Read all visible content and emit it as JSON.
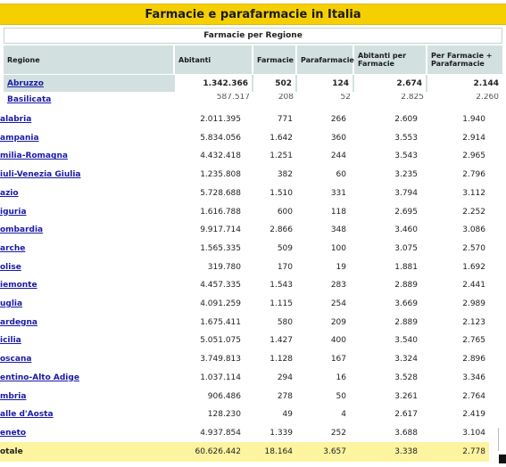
{
  "title": "Farmacie e parafarmacie in Italia",
  "caption": "Farmacie per Regione",
  "headers": [
    "Regione",
    "Abitanti",
    "Farmacie",
    "Parafarmacie",
    "Abitanti per Farmacie",
    "Per Farmacie + Parafarmacie"
  ],
  "highlight_row": {
    "region": "Abruzzo",
    "abitanti": "1.342.366",
    "farmacie": "502",
    "parafarmacie": "124",
    "ab_farmacie": "2.674",
    "ab_farm_para": "2.144"
  },
  "partial_row": {
    "region": "Basilicata",
    "abitanti": "587.517",
    "farmacie": "208",
    "parafarmacie": "52",
    "ab_farmacie": "2.825",
    "ab_farm_para": "2.260"
  },
  "rows": [
    {
      "region": "alabria",
      "abitanti": "2.011.395",
      "farmacie": "771",
      "parafarmacie": "266",
      "ab_farmacie": "2.609",
      "ab_farm_para": "1.940"
    },
    {
      "region": "ampania",
      "abitanti": "5.834.056",
      "farmacie": "1.642",
      "parafarmacie": "360",
      "ab_farmacie": "3.553",
      "ab_farm_para": "2.914"
    },
    {
      "region": "milia-Romagna",
      "abitanti": "4.432.418",
      "farmacie": "1.251",
      "parafarmacie": "244",
      "ab_farmacie": "3.543",
      "ab_farm_para": "2.965"
    },
    {
      "region": "iuli-Venezia Giulia",
      "abitanti": "1.235.808",
      "farmacie": "382",
      "parafarmacie": "60",
      "ab_farmacie": "3.235",
      "ab_farm_para": "2.796"
    },
    {
      "region": "azio",
      "abitanti": "5.728.688",
      "farmacie": "1.510",
      "parafarmacie": "331",
      "ab_farmacie": "3.794",
      "ab_farm_para": "3.112"
    },
    {
      "region": "iguria",
      "abitanti": "1.616.788",
      "farmacie": "600",
      "parafarmacie": "118",
      "ab_farmacie": "2.695",
      "ab_farm_para": "2.252"
    },
    {
      "region": "ombardia",
      "abitanti": "9.917.714",
      "farmacie": "2.866",
      "parafarmacie": "348",
      "ab_farmacie": "3.460",
      "ab_farm_para": "3.086"
    },
    {
      "region": "arche",
      "abitanti": "1.565.335",
      "farmacie": "509",
      "parafarmacie": "100",
      "ab_farmacie": "3.075",
      "ab_farm_para": "2.570"
    },
    {
      "region": "olise",
      "abitanti": "319.780",
      "farmacie": "170",
      "parafarmacie": "19",
      "ab_farmacie": "1.881",
      "ab_farm_para": "1.692"
    },
    {
      "region": "iemonte",
      "abitanti": "4.457.335",
      "farmacie": "1.543",
      "parafarmacie": "283",
      "ab_farmacie": "2.889",
      "ab_farm_para": "2.441"
    },
    {
      "region": "uglia",
      "abitanti": "4.091.259",
      "farmacie": "1.115",
      "parafarmacie": "254",
      "ab_farmacie": "3.669",
      "ab_farm_para": "2.989"
    },
    {
      "region": "ardegna",
      "abitanti": "1.675.411",
      "farmacie": "580",
      "parafarmacie": "209",
      "ab_farmacie": "2.889",
      "ab_farm_para": "2.123"
    },
    {
      "region": "icilia",
      "abitanti": "5.051.075",
      "farmacie": "1.427",
      "parafarmacie": "400",
      "ab_farmacie": "3.540",
      "ab_farm_para": "2.765"
    },
    {
      "region": "oscana",
      "abitanti": "3.749.813",
      "farmacie": "1.128",
      "parafarmacie": "167",
      "ab_farmacie": "3.324",
      "ab_farm_para": "2.896"
    },
    {
      "region": "entino-Alto Adige",
      "abitanti": "1.037.114",
      "farmacie": "294",
      "parafarmacie": "16",
      "ab_farmacie": "3.528",
      "ab_farm_para": "3.346"
    },
    {
      "region": "mbria",
      "abitanti": "906.486",
      "farmacie": "278",
      "parafarmacie": "50",
      "ab_farmacie": "3.261",
      "ab_farm_para": "2.764"
    },
    {
      "region": "alle d'Aosta",
      "abitanti": "128.230",
      "farmacie": "49",
      "parafarmacie": "4",
      "ab_farmacie": "2.617",
      "ab_farm_para": "2.419"
    },
    {
      "region": "eneto",
      "abitanti": "4.937.854",
      "farmacie": "1.339",
      "parafarmacie": "252",
      "ab_farmacie": "3.688",
      "ab_farm_para": "3.104"
    }
  ],
  "total": {
    "region": "otale",
    "abitanti": "60.626.442",
    "farmacie": "18.164",
    "parafarmacie": "3.657",
    "ab_farmacie": "3.338",
    "ab_farm_para": "2.778"
  },
  "colors": {
    "title_bg": "#f5cf00",
    "header_bg": "#d3e0e0",
    "total_bg": "#fdf4a0",
    "link": "#1a1aa6"
  }
}
